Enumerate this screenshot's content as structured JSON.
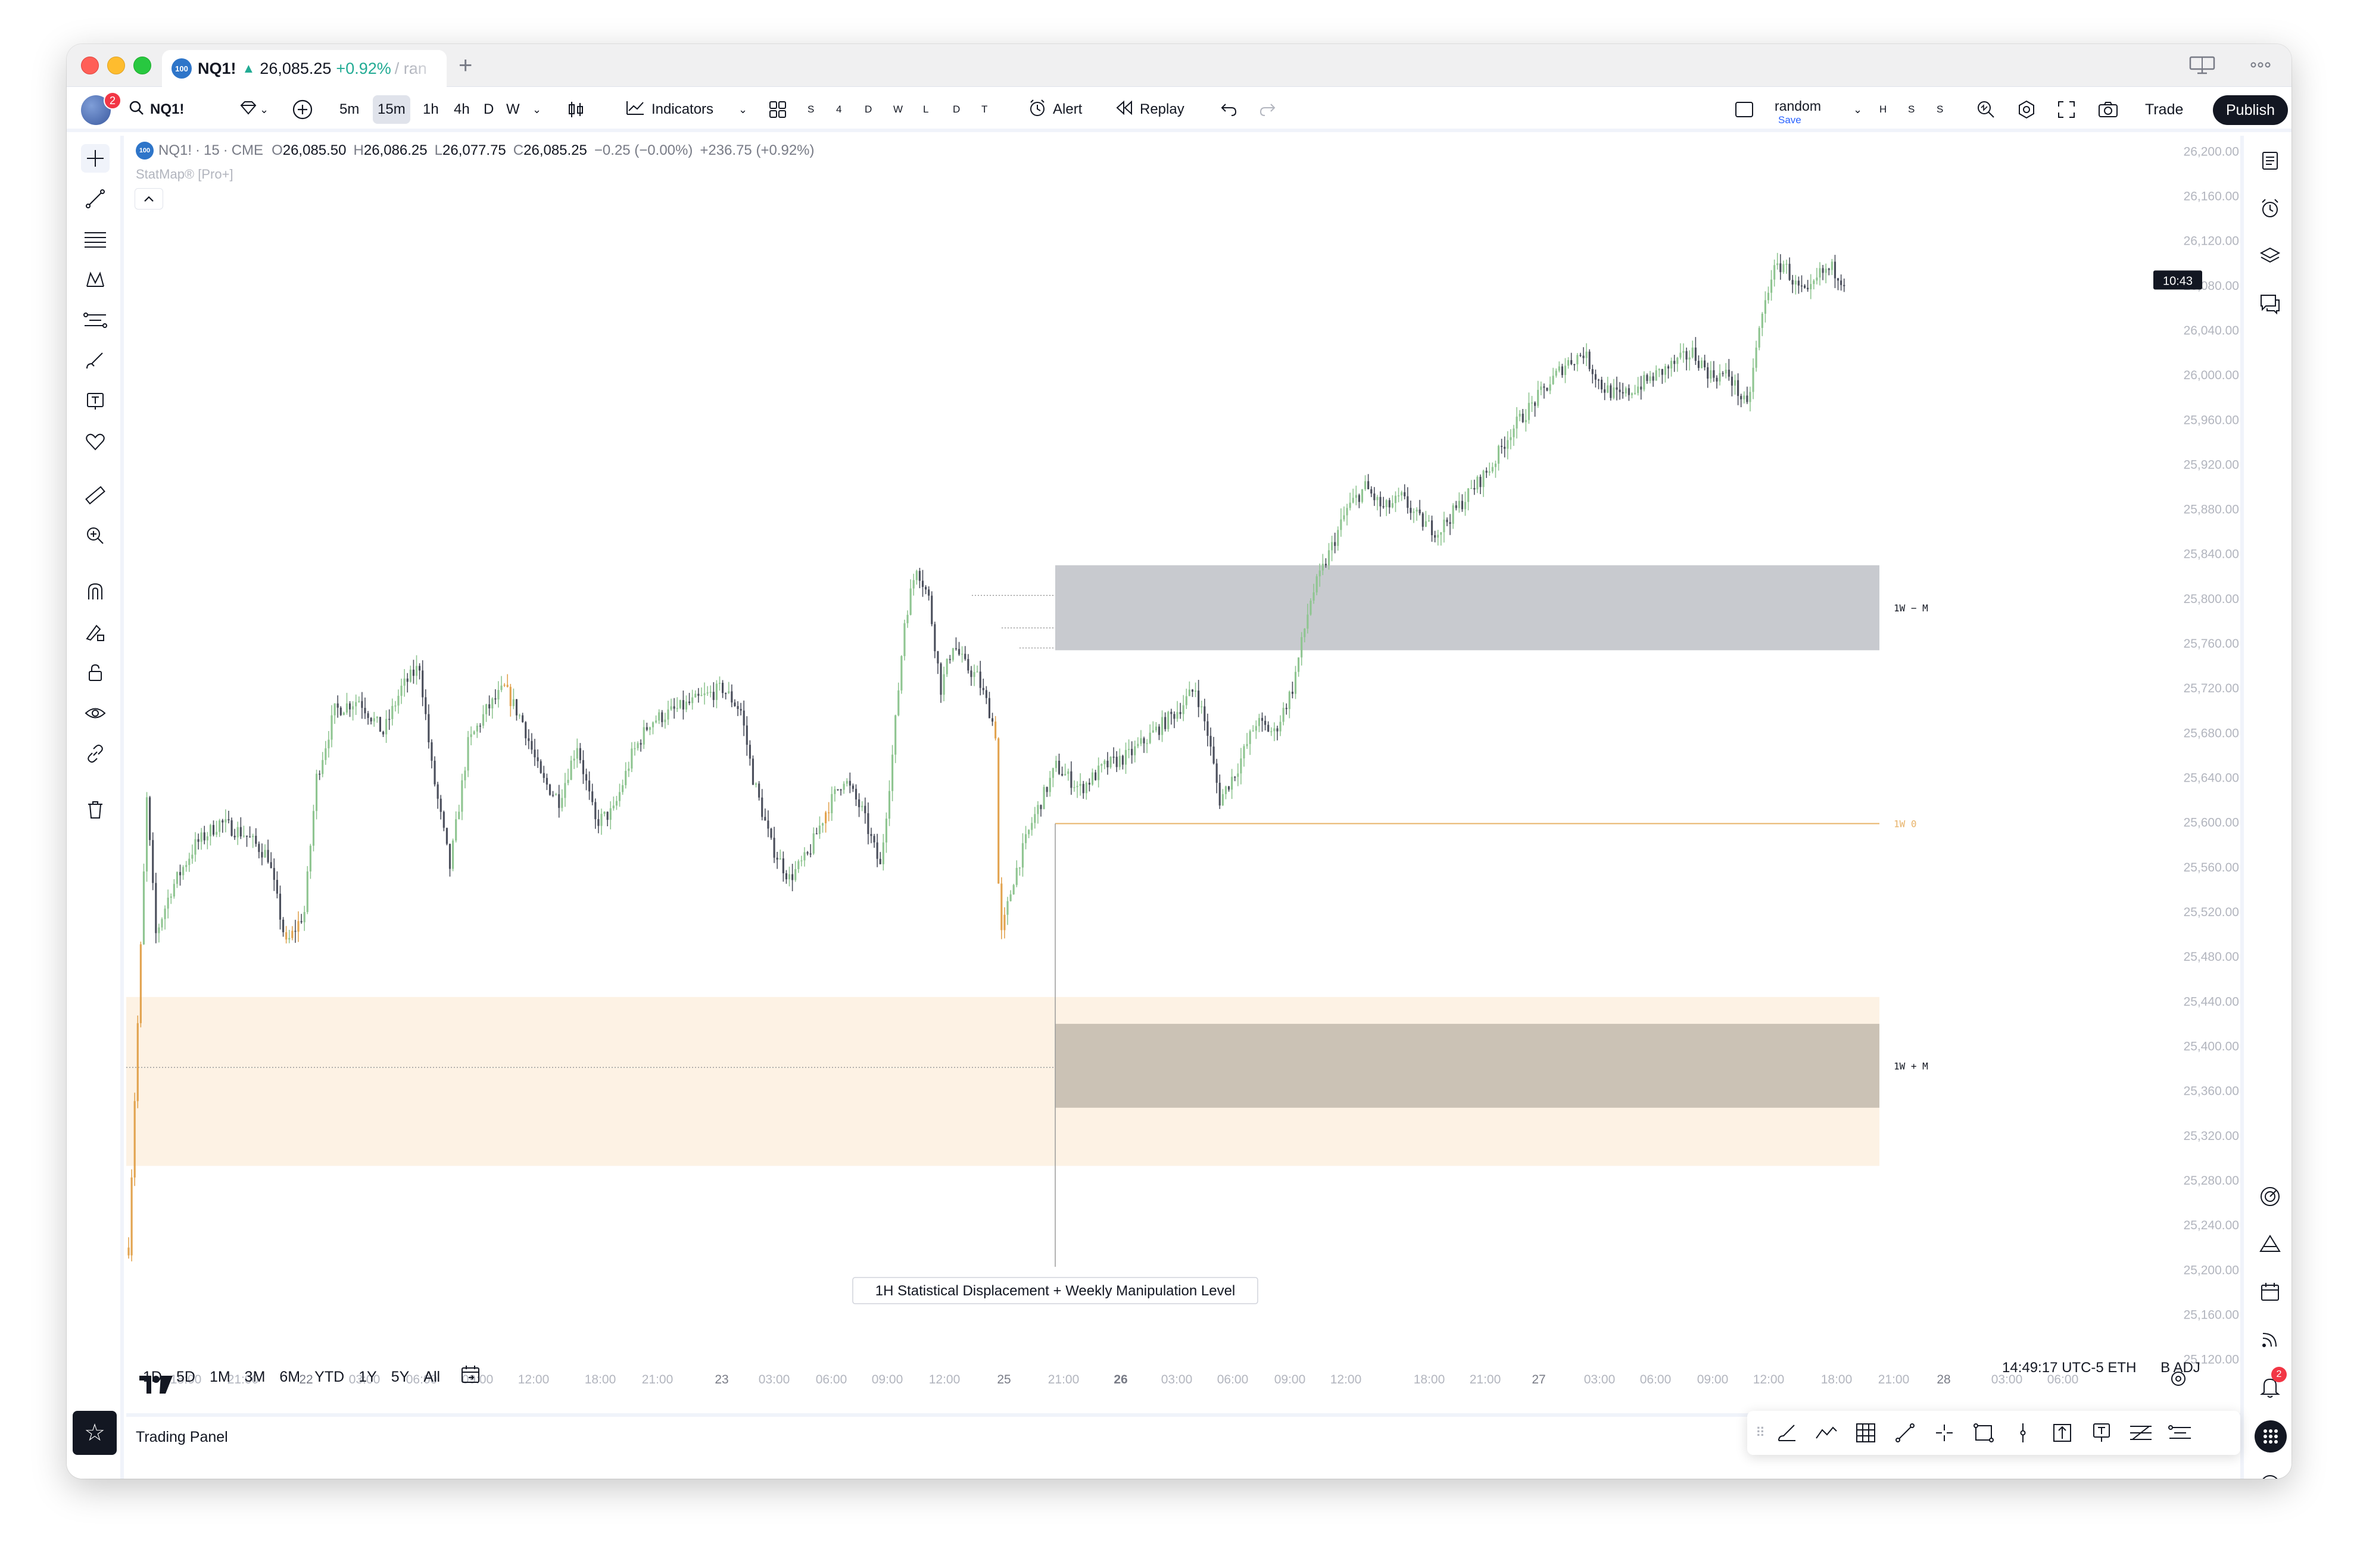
{
  "tab": {
    "symbol_badge": "100",
    "symbol": "NQ1!",
    "arrow": "▲",
    "price": "26,085.25",
    "change": "+0.92%",
    "rest": "/ ran"
  },
  "toolbar": {
    "avatar_badge": "2",
    "symbol": "NQ1!",
    "intervals": [
      "5m",
      "15m",
      "1h",
      "4h",
      "D",
      "W"
    ],
    "active_interval": "15m",
    "indicators_label": "Indicators",
    "layout_letters": [
      "S",
      "4",
      "D",
      "W",
      "L",
      "D",
      "T"
    ],
    "alert_label": "Alert",
    "replay_label": "Replay",
    "layout_name": "random",
    "save_label": "Save",
    "right_letters": [
      "H",
      "S",
      "S"
    ],
    "trade_label": "Trade",
    "publish_label": "Publish"
  },
  "legend": {
    "badge": "100",
    "symbol": "NQ1!",
    "interval": "15",
    "exchange": "CME",
    "o_label": "O",
    "o_value": "26,085.50",
    "h_label": "H",
    "h_value": "26,086.25",
    "l_label": "L",
    "l_value": "26,077.75",
    "c_label": "C",
    "c_value": "26,085.25",
    "change": "−0.25 (−0.00%)",
    "change_since": "+236.75 (+0.92%)",
    "indicator": "StatMap® [Pro+]",
    "collapse_icon": "chevron-up"
  },
  "chart_data": {
    "type": "candlestick",
    "y_axis_ticks": [
      26200,
      26160,
      26120,
      26080,
      26040,
      26000,
      25960,
      25920,
      25880,
      25840,
      25800,
      25760,
      25720,
      25680,
      25640,
      25600,
      25560,
      25520,
      25480,
      25440,
      25400,
      25360,
      25320,
      25280,
      25240,
      25200,
      25160,
      25120
    ],
    "ylim": [
      25107,
      26214
    ],
    "current_price_label": "10:43",
    "time_ticks": [
      "18:00",
      "21:00",
      "22",
      "03:00",
      "06:00",
      "09:00",
      "12:00",
      "18:00",
      "21:00",
      "23",
      "03:00",
      "06:00",
      "09:00",
      "12:00",
      "25",
      "21:00",
      "26",
      "03:00",
      "06:00",
      "09:00",
      "12:00",
      "18:00",
      "21:00",
      "27",
      "03:00",
      "06:00",
      "09:00",
      "12:00",
      "18:00",
      "21:00",
      "28",
      "03:00",
      "06:00"
    ],
    "zones": [
      {
        "name": "1W - M",
        "from": 25754,
        "to": 25830,
        "color": "#c5c7cc",
        "label": "1W − M"
      },
      {
        "name": "1W + M",
        "from": 25345,
        "to": 25420,
        "color": "#c8bfb2",
        "label": "1W + M"
      },
      {
        "name": "1H displacement",
        "from": 25293,
        "to": 25444,
        "color": "#fdf2e4"
      }
    ],
    "levels": [
      {
        "name": "1W 0",
        "value": 25599,
        "color": "#e8b36a",
        "label": "1W  0"
      }
    ],
    "annotation": "1H Statistical Displacement + Weekly Manipulation Level",
    "price_path": [
      [
        0,
        25220
      ],
      [
        3,
        25420
      ],
      [
        6,
        25620
      ],
      [
        9,
        25500
      ],
      [
        14,
        25540
      ],
      [
        22,
        25580
      ],
      [
        30,
        25600
      ],
      [
        38,
        25590
      ],
      [
        46,
        25570
      ],
      [
        52,
        25490
      ],
      [
        58,
        25520
      ],
      [
        62,
        25640
      ],
      [
        68,
        25700
      ],
      [
        76,
        25710
      ],
      [
        84,
        25680
      ],
      [
        90,
        25720
      ],
      [
        96,
        25740
      ],
      [
        100,
        25650
      ],
      [
        106,
        25560
      ],
      [
        112,
        25670
      ],
      [
        118,
        25700
      ],
      [
        124,
        25720
      ],
      [
        130,
        25690
      ],
      [
        136,
        25640
      ],
      [
        142,
        25620
      ],
      [
        148,
        25670
      ],
      [
        154,
        25600
      ],
      [
        160,
        25610
      ],
      [
        166,
        25660
      ],
      [
        172,
        25690
      ],
      [
        180,
        25700
      ],
      [
        188,
        25710
      ],
      [
        196,
        25720
      ],
      [
        202,
        25700
      ],
      [
        206,
        25640
      ],
      [
        212,
        25580
      ],
      [
        218,
        25550
      ],
      [
        224,
        25570
      ],
      [
        230,
        25610
      ],
      [
        236,
        25640
      ],
      [
        242,
        25610
      ],
      [
        248,
        25560
      ],
      [
        252,
        25660
      ],
      [
        256,
        25780
      ],
      [
        260,
        25830
      ],
      [
        264,
        25800
      ],
      [
        268,
        25720
      ],
      [
        272,
        25760
      ],
      [
        276,
        25740
      ],
      [
        280,
        25730
      ],
      [
        284,
        25700
      ],
      [
        286,
        25680
      ],
      [
        286,
        25590
      ],
      [
        288,
        25500
      ],
      [
        292,
        25550
      ],
      [
        298,
        25600
      ],
      [
        306,
        25650
      ],
      [
        314,
        25630
      ],
      [
        322,
        25650
      ],
      [
        330,
        25660
      ],
      [
        338,
        25680
      ],
      [
        346,
        25700
      ],
      [
        352,
        25720
      ],
      [
        356,
        25680
      ],
      [
        360,
        25620
      ],
      [
        366,
        25650
      ],
      [
        372,
        25690
      ],
      [
        378,
        25680
      ],
      [
        384,
        25720
      ],
      [
        390,
        25800
      ],
      [
        396,
        25840
      ],
      [
        402,
        25880
      ],
      [
        408,
        25900
      ],
      [
        414,
        25880
      ],
      [
        420,
        25890
      ],
      [
        426,
        25870
      ],
      [
        432,
        25860
      ],
      [
        438,
        25880
      ],
      [
        444,
        25900
      ],
      [
        450,
        25920
      ],
      [
        456,
        25950
      ],
      [
        462,
        25970
      ],
      [
        468,
        25990
      ],
      [
        474,
        26010
      ],
      [
        480,
        26020
      ],
      [
        486,
        25990
      ],
      [
        492,
        25980
      ],
      [
        498,
        25990
      ],
      [
        504,
        26000
      ],
      [
        510,
        26010
      ],
      [
        516,
        26020
      ],
      [
        522,
        26000
      ],
      [
        528,
        26000
      ],
      [
        534,
        25970
      ],
      [
        538,
        26040
      ],
      [
        542,
        26090
      ],
      [
        546,
        26100
      ],
      [
        550,
        26080
      ],
      [
        554,
        26070
      ],
      [
        558,
        26090
      ],
      [
        562,
        26095
      ],
      [
        566,
        26085
      ]
    ]
  },
  "bottom_bar": {
    "ranges": [
      "1D",
      "5D",
      "1M",
      "3M",
      "6M",
      "YTD",
      "1Y",
      "5Y",
      "All"
    ],
    "timezone": "14:49:17 UTC-5  ETH",
    "adj": "B ADJ"
  },
  "trading_panel": {
    "label": "Trading Panel"
  },
  "right_sidebar": {
    "alert_badge": "2"
  }
}
